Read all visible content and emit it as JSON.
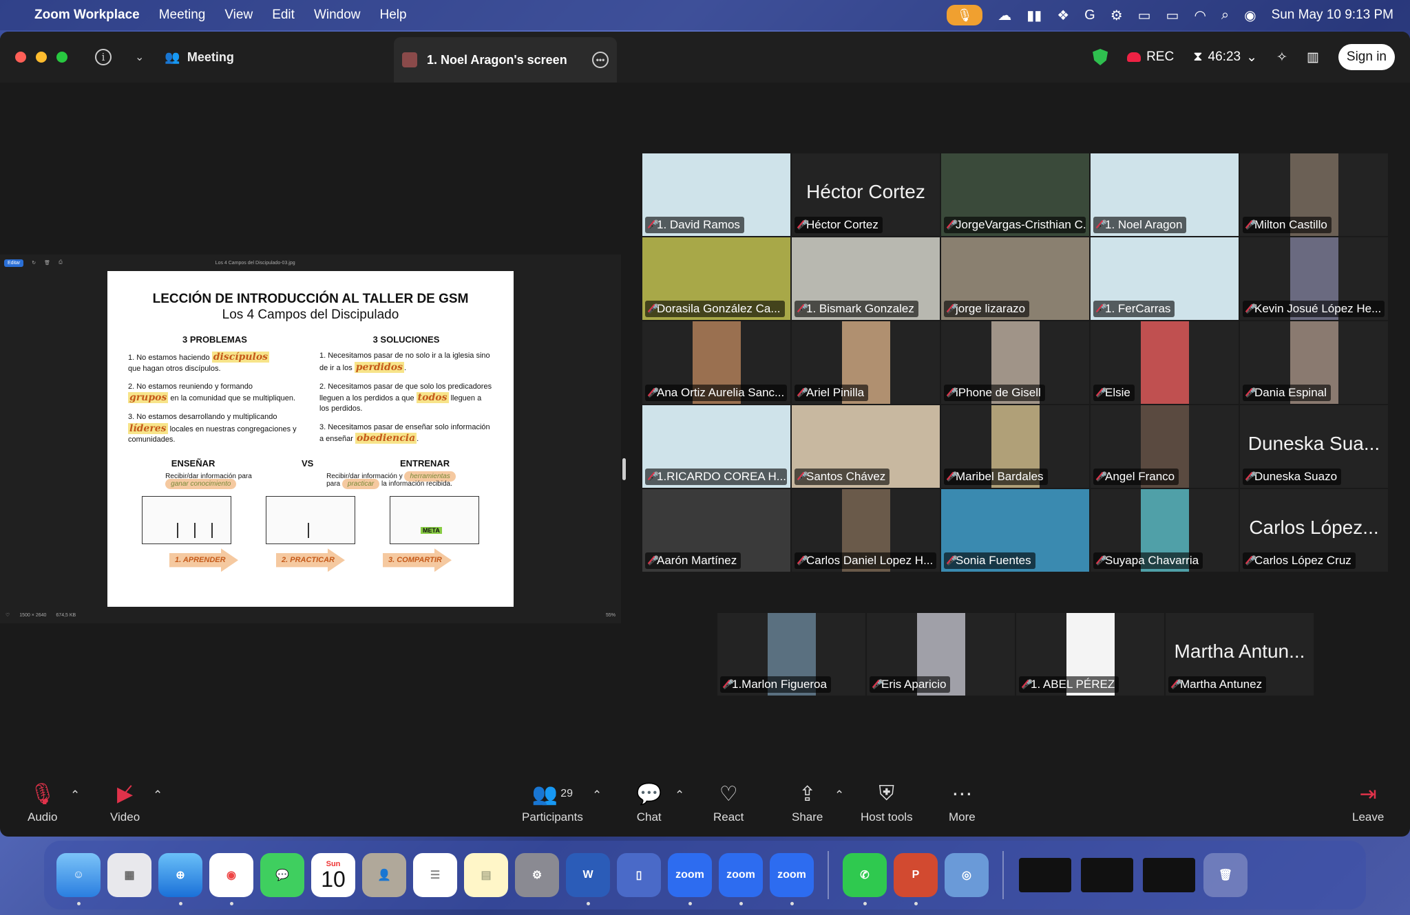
{
  "menubar": {
    "app_name": "Zoom Workplace",
    "menus": [
      "Meeting",
      "View",
      "Edit",
      "Window",
      "Help"
    ],
    "clock": "Sun May 10  9:13 PM"
  },
  "titlebar": {
    "meeting_label": "Meeting",
    "tab_label": "1. Noel Aragon's screen",
    "rec_label": "REC",
    "timer": "46:23",
    "signin_label": "Sign in"
  },
  "share": {
    "filename": "Los 4 Campos del Discipulado-03.jpg",
    "zoom_level": "55%",
    "dimensions": "1500 × 2640",
    "filesize": "674,5 KB",
    "slide": {
      "title1": "LECCIÓN DE INTRODUCCIÓN AL TALLER DE GSM",
      "title2": "Los 4 Campos del Discipulado",
      "problems_header": "3 PROBLEMAS",
      "solutions_header": "3 SOLUCIONES",
      "p1_a": "1. No estamos haciendo",
      "p1_hl": "discípulos",
      "p1_b": "que hagan otros discípulos.",
      "p2_a": "2. No estamos reuniendo y formando",
      "p2_hl": "grupos",
      "p2_b": "en la comunidad que se multipliquen.",
      "p3_a": "3. No estamos desarrollando y multiplicando",
      "p3_hl": "líderes",
      "p3_b": "locales en nuestras congregaciones y comunidades.",
      "s1_a": "1. Necesitamos pasar de no solo ir a la iglesia sino de ir a los",
      "s1_hl": "perdidos",
      "s2_a": "2. Necesitamos pasar de que solo los predicadores lleguen a los perdidos a que",
      "s2_hl": "todos",
      "s2_b": "lleguen a los perdidos.",
      "s3_a": "3. Necesitamos pasar de enseñar solo información a enseñar",
      "s3_hl": "obediencia",
      "ensenar": "ENSEÑAR",
      "vs": "VS",
      "entrenar": "ENTRENAR",
      "ensenar_desc": "Recibir/dar información para",
      "ensenar_pill": "ganar conocimiento",
      "entrenar_desc_a": "Recibir/dar información y",
      "entrenar_pill1": "herramientas",
      "entrenar_desc_b": "para",
      "entrenar_pill2": "practicar",
      "entrenar_desc_c": "la información recibida.",
      "arrow1": "1. APRENDER",
      "arrow2": "2. PRACTICAR",
      "arrow3": "3. COMPARTIR",
      "meta_label": "META"
    }
  },
  "participants": [
    {
      "name": "1. David Ramos",
      "video": true,
      "bg": "#cfe3ea"
    },
    {
      "name": "Héctor Cortez",
      "video": false,
      "big": "Héctor Cortez"
    },
    {
      "name": "JorgeVargas-Cristhian C...",
      "video": true,
      "bg": "#3a4a3a",
      "speaking": true
    },
    {
      "name": "1. Noel Aragon",
      "video": true,
      "bg": "#cfe3ea"
    },
    {
      "name": "Milton Castillo",
      "video": true,
      "bg": "#6b6055",
      "portrait": true
    },
    {
      "name": "Dorasila González Ca...",
      "video": true,
      "bg": "#a8a848"
    },
    {
      "name": "1. Bismark Gonzalez",
      "video": true,
      "bg": "#b8b8b0"
    },
    {
      "name": "jorge lizarazo",
      "video": true,
      "bg": "#8a8070"
    },
    {
      "name": "1. FerCarras",
      "video": true,
      "bg": "#cfe3ea"
    },
    {
      "name": "Kevin Josué López He...",
      "video": true,
      "bg": "#6a6a80",
      "portrait": true
    },
    {
      "name": "Ana Ortiz Aurelia Sanc...",
      "video": true,
      "bg": "#9a7050",
      "portrait": true
    },
    {
      "name": "Ariel Pinilla",
      "video": true,
      "bg": "#b09070",
      "portrait": true
    },
    {
      "name": "iPhone de Gisell",
      "video": true,
      "bg": "#a09488",
      "portrait": true
    },
    {
      "name": "Elsie",
      "video": true,
      "bg": "#c05050",
      "portrait": true
    },
    {
      "name": "Dania Espinal",
      "video": true,
      "bg": "#8a7a70",
      "portrait": true
    },
    {
      "name": "1.RICARDO COREA H...",
      "video": true,
      "bg": "#cfe3ea"
    },
    {
      "name": "Santos Chávez",
      "video": true,
      "bg": "#c8b8a0"
    },
    {
      "name": "Maribel Bardales",
      "video": true,
      "bg": "#b0a078",
      "portrait": true
    },
    {
      "name": "Angel Franco",
      "video": true,
      "bg": "#5a4a40",
      "portrait": true
    },
    {
      "name": "Duneska Suazo",
      "video": false,
      "big": "Duneska Sua..."
    },
    {
      "name": "Aarón Martínez",
      "video": true,
      "bg": "#3a3a3a"
    },
    {
      "name": "Carlos Daniel Lopez H...",
      "video": true,
      "bg": "#6a5a4a",
      "portrait": true
    },
    {
      "name": "Sonia Fuentes",
      "video": true,
      "bg": "#3a8ab0"
    },
    {
      "name": "Suyapa Chavarria",
      "video": true,
      "bg": "#50a0a8",
      "portrait": true
    },
    {
      "name": "Carlos López Cruz",
      "video": false,
      "big": "Carlos López..."
    }
  ],
  "participants_last": [
    {
      "name": "1.Marlon Figueroa",
      "video": true,
      "bg": "#5a7080",
      "portrait": true
    },
    {
      "name": "Eris Aparicio",
      "video": true,
      "bg": "#a0a0a8",
      "portrait": true
    },
    {
      "name": "1. ABEL PÉREZ",
      "video": true,
      "bg": "#f4f4f4",
      "portrait": true
    },
    {
      "name": "Martha Antunez",
      "video": false,
      "big": "Martha Antun..."
    }
  ],
  "toolbar": {
    "audio": "Audio",
    "video": "Video",
    "participants": "Participants",
    "participants_count": "29",
    "chat": "Chat",
    "react": "React",
    "share": "Share",
    "host_tools": "Host tools",
    "more": "More",
    "leave": "Leave"
  },
  "dock": {
    "calendar_month": "Sun",
    "calendar_day": "10",
    "zoom_label": "zoom",
    "word_label": "W",
    "ppt_label": "P"
  }
}
